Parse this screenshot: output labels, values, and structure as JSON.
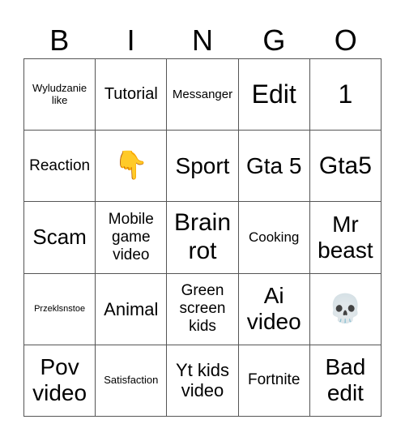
{
  "header": [
    "B",
    "I",
    "N",
    "G",
    "O"
  ],
  "cells": [
    {
      "text": "Wyludzanie like",
      "size": "s13"
    },
    {
      "text": "Tutorial",
      "size": "s20"
    },
    {
      "text": "Messanger",
      "size": "s15"
    },
    {
      "text": "Edit",
      "size": "s32"
    },
    {
      "text": "1",
      "size": "s32"
    },
    {
      "text": "Reaction",
      "size": "s19"
    },
    {
      "text": "👇",
      "size": "emoji",
      "icon": "pointing-down-hand-icon"
    },
    {
      "text": "Sport",
      "size": "s28"
    },
    {
      "text": "Gta 5",
      "size": "s28"
    },
    {
      "text": "Gta5",
      "size": "s30"
    },
    {
      "text": "Scam",
      "size": "s26"
    },
    {
      "text": "Mobile game video",
      "size": "s19"
    },
    {
      "text": "Brain rot",
      "size": "s30"
    },
    {
      "text": "Cooking",
      "size": "s17"
    },
    {
      "text": "Mr beast",
      "size": "s28"
    },
    {
      "text": "Przeklsnstoe",
      "size": "s11"
    },
    {
      "text": "Animal",
      "size": "s22"
    },
    {
      "text": "Green screen kids",
      "size": "s19"
    },
    {
      "text": "Ai video",
      "size": "s28"
    },
    {
      "text": "💀",
      "size": "emoji",
      "icon": "skull-icon"
    },
    {
      "text": "Pov video",
      "size": "s28"
    },
    {
      "text": "Satisfaction",
      "size": "s13"
    },
    {
      "text": "Yt kids video",
      "size": "s22"
    },
    {
      "text": "Fortnite",
      "size": "s19"
    },
    {
      "text": "Bad edit",
      "size": "s28"
    }
  ]
}
